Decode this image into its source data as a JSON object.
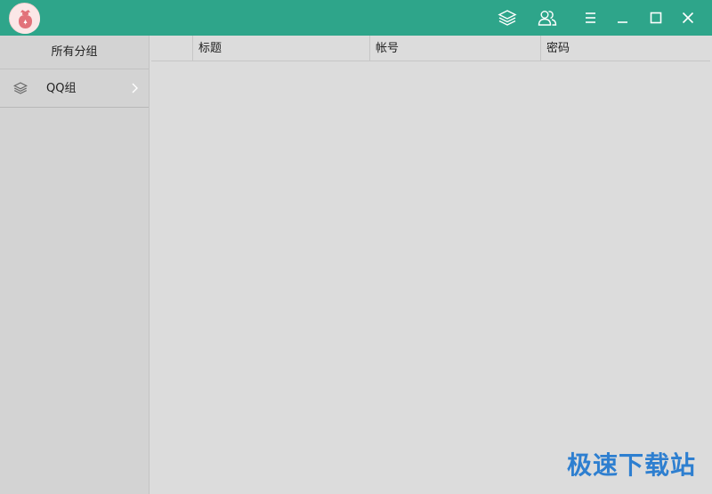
{
  "titlebar": {
    "accent_color": "#2ea58a",
    "icons": [
      "layers-icon",
      "users-icon",
      "menu-icon",
      "minimize-icon",
      "maximize-icon",
      "close-icon"
    ]
  },
  "sidebar": {
    "header": "所有分组",
    "items": [
      {
        "label": "QQ组",
        "icon": "layers-icon"
      }
    ]
  },
  "table": {
    "columns": [
      "",
      "标题",
      "帐号",
      "密码"
    ]
  },
  "watermark": "极速下载站"
}
